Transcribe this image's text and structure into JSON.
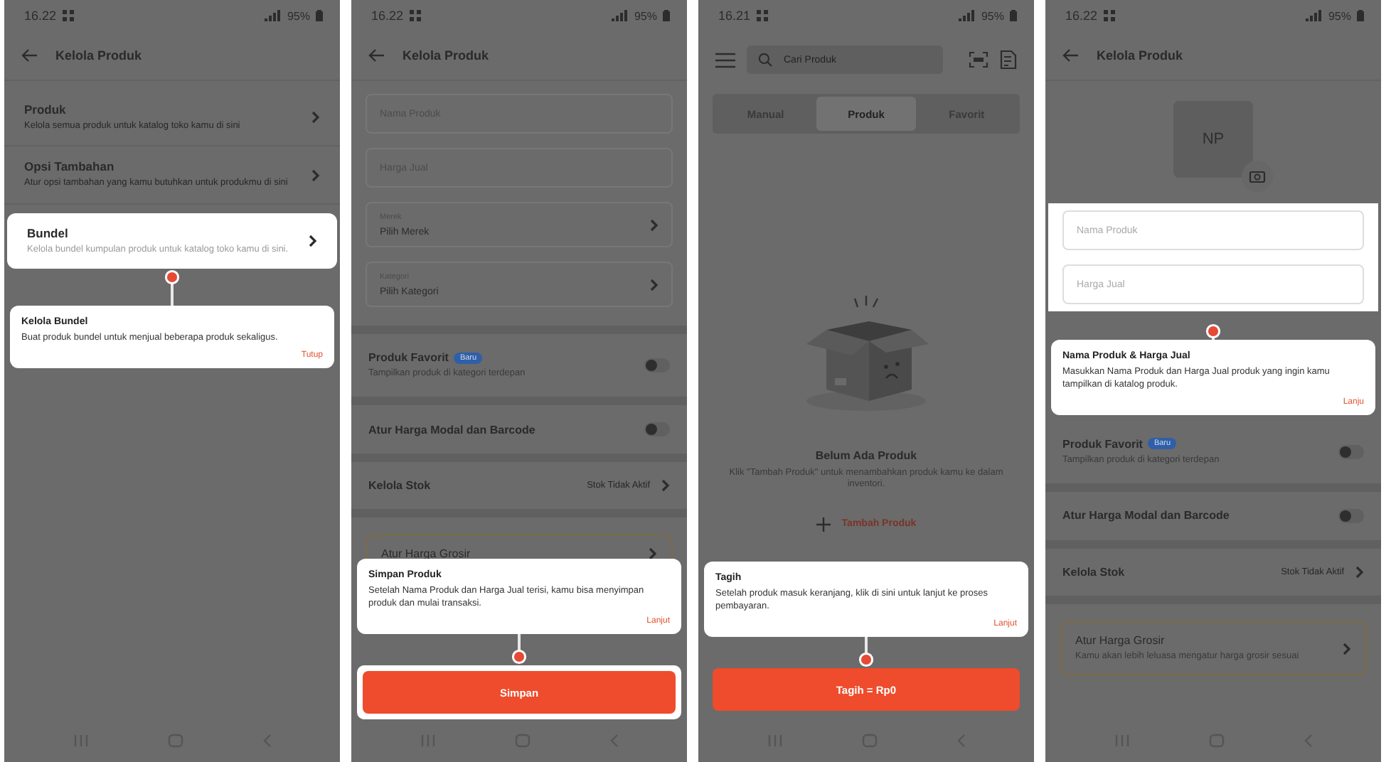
{
  "screens": [
    {
      "kind": "menu",
      "status": {
        "time": "16.22",
        "battery": "95%"
      },
      "header": {
        "title": "Kelola Produk"
      },
      "menu_items": [
        {
          "title": "Produk",
          "description": "Kelola semua produk untuk katalog toko kamu di sini",
          "highlighted": false
        },
        {
          "title": "Opsi Tambahan",
          "description": "Atur opsi tambahan yang kamu butuhkan untuk produkmu di sini",
          "highlighted": false
        },
        {
          "title": "Bundel",
          "description": "Kelola bundel kumpulan produk untuk katalog toko kamu di sini.",
          "highlighted": true
        }
      ],
      "tooltip": {
        "title": "Kelola Bundel",
        "text": "Buat produk bundel untuk menjual beberapa produk sekaligus.",
        "action": "Tutup"
      }
    },
    {
      "kind": "form",
      "status": {
        "time": "16.22",
        "battery": "95%"
      },
      "header": {
        "title": "Kelola Produk"
      },
      "fields": [
        {
          "kind": "text",
          "placeholder": "Nama Produk",
          "highlighted": false
        },
        {
          "kind": "text",
          "placeholder": "Harga Jual",
          "highlighted": false
        },
        {
          "kind": "select",
          "label": "Merek",
          "value": "Pilih Merek",
          "highlighted": false
        },
        {
          "kind": "select",
          "label": "Kategori",
          "value": "Pilih Kategori",
          "highlighted": false
        }
      ],
      "settings": [
        {
          "kind": "toggle",
          "title": "Produk Favorit",
          "badge": "Baru",
          "description": "Tampilkan produk di kategori terdepan",
          "on": false
        },
        {
          "kind": "toggle",
          "title": "Atur Harga Modal dan Barcode",
          "on": false
        },
        {
          "kind": "link",
          "title": "Kelola Stok",
          "value": "Stok Tidak Aktif"
        },
        {
          "kind": "card",
          "title": "Atur Harga Grosir"
        }
      ],
      "tooltip": {
        "title": "Simpan Produk",
        "text": "Setelah Nama Produk dan Harga Jual terisi, kamu bisa menyimpan produk dan mulai transaksi.",
        "action": "Lanjut"
      },
      "primary_button": "Simpan"
    },
    {
      "kind": "catalog",
      "status": {
        "time": "16.21",
        "battery": "95%"
      },
      "search": {
        "placeholder": "Cari Produk"
      },
      "tabs": [
        {
          "label": "Manual",
          "selected": false
        },
        {
          "label": "Produk",
          "selected": true
        },
        {
          "label": "Favorit",
          "selected": false
        }
      ],
      "empty_state": {
        "title": "Belum Ada Produk",
        "text": "Klik \"Tambah Produk\" untuk menambahkan produk kamu ke dalam inventori.",
        "action": "Tambah Produk"
      },
      "tooltip": {
        "title": "Tagih",
        "text": "Setelah produk masuk keranjang, klik di sini untuk lanjut ke proses pembayaran.",
        "action": "Lanjut"
      },
      "primary_button": "Tagih = Rp0"
    },
    {
      "kind": "form_intro",
      "status": {
        "time": "16.22",
        "battery": "95%"
      },
      "header": {
        "title": "Kelola Produk"
      },
      "avatar": "NP",
      "fields": [
        {
          "kind": "text",
          "placeholder": "Nama Produk",
          "highlighted": true
        },
        {
          "kind": "text",
          "placeholder": "Harga Jual",
          "highlighted": true
        }
      ],
      "tooltip": {
        "title": "Nama Produk & Harga Jual",
        "text": "Masukkan Nama Produk dan Harga Jual produk yang ingin kamu tampilkan di katalog produk.",
        "action": "Lanju"
      },
      "settings": [
        {
          "kind": "toggle",
          "title": "Produk Favorit",
          "badge": "Baru",
          "description": "Tampilkan produk di kategori terdepan",
          "on": false
        },
        {
          "kind": "toggle",
          "title": "Atur Harga Modal dan Barcode",
          "on": false
        },
        {
          "kind": "link",
          "title": "Kelola Stok",
          "value": "Stok Tidak Aktif"
        },
        {
          "kind": "card",
          "title": "Atur Harga Grosir",
          "description": "Kamu akan lebih leluasa mengatur harga grosir sesuai"
        }
      ]
    }
  ]
}
